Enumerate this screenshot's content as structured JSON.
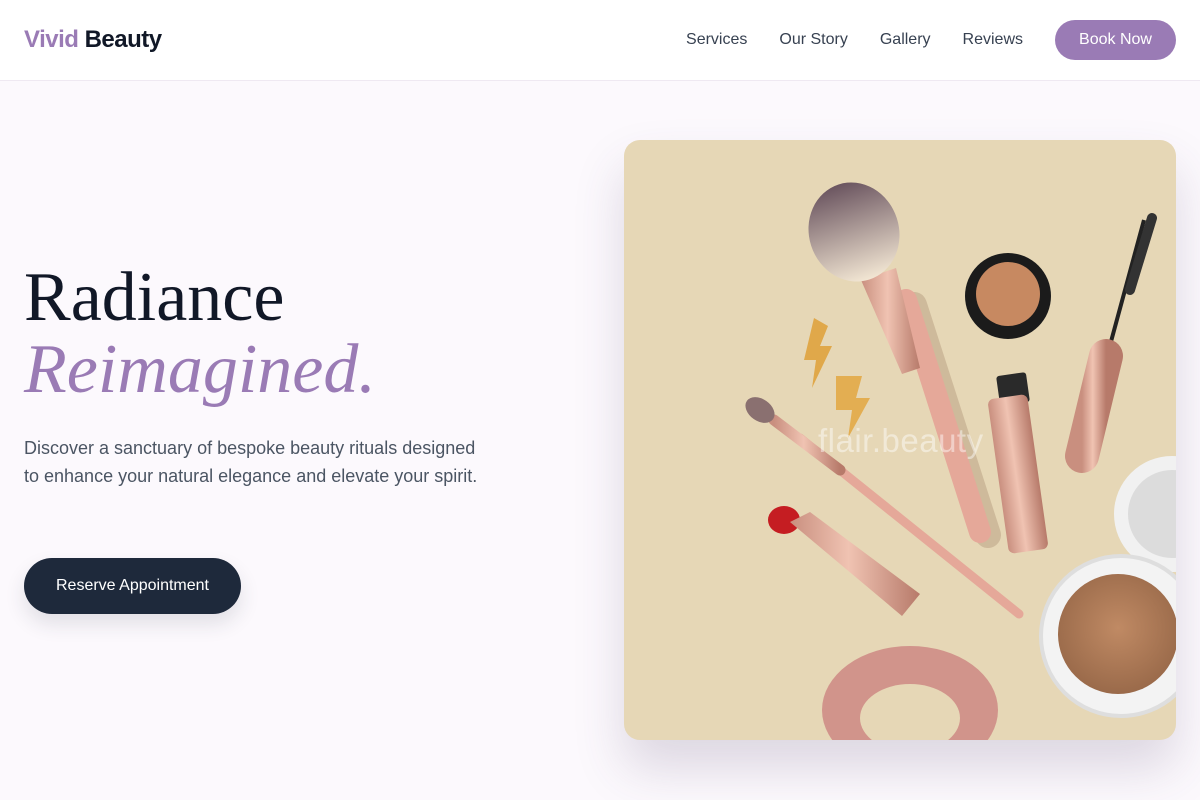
{
  "brand": {
    "accent": "Vivid",
    "main": "Beauty"
  },
  "nav": {
    "links": [
      "Services",
      "Our Story",
      "Gallery",
      "Reviews"
    ],
    "cta": "Book Now"
  },
  "hero": {
    "title_line1": "Radiance",
    "title_line2": "Reimagined.",
    "description": "Discover a sanctuary of bespoke beauty rituals designed to enhance your natural elegance and elevate your spirit.",
    "cta": "Reserve Appointment",
    "image_watermark": "flair.beauty"
  },
  "colors": {
    "accent": "#9a7bb5",
    "dark": "#1e293b",
    "page_background": "#fcf9fd",
    "image_background": "#e6d7b6"
  }
}
